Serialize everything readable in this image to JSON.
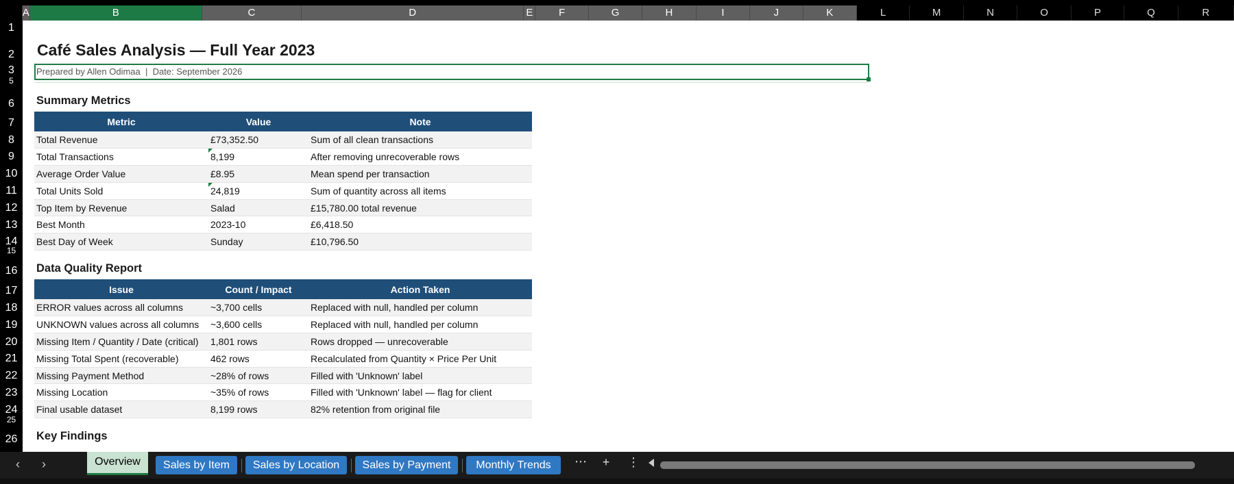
{
  "columns": [
    "A",
    "B",
    "C",
    "D",
    "E",
    "F",
    "G",
    "H",
    "I",
    "J",
    "K",
    "L",
    "M",
    "N",
    "O",
    "P",
    "Q",
    "R"
  ],
  "rows": [
    "1",
    "2",
    "3",
    "5",
    "6",
    "7",
    "8",
    "9",
    "10",
    "11",
    "12",
    "13",
    "14",
    "15",
    "16",
    "17",
    "18",
    "19",
    "20",
    "21",
    "22",
    "23",
    "24",
    "25",
    "26"
  ],
  "title": "Café Sales Analysis — Full Year 2023",
  "subtitle": "Prepared by Allen Odimaa  |  Date: September 2026",
  "summary": {
    "heading": "Summary Metrics",
    "headers": [
      "Metric",
      "Value",
      "Note"
    ],
    "rows": [
      [
        "Total Revenue",
        "£73,352.50",
        "Sum of all clean transactions"
      ],
      [
        "Total Transactions",
        "8,199",
        "After removing unrecoverable rows"
      ],
      [
        "Average Order Value",
        "£8.95",
        "Mean spend per transaction"
      ],
      [
        "Total Units Sold",
        "24,819",
        "Sum of quantity across all items"
      ],
      [
        "Top Item by Revenue",
        "Salad",
        "£15,780.00 total revenue"
      ],
      [
        "Best Month",
        "2023-10",
        "£6,418.50"
      ],
      [
        "Best Day of Week",
        "Sunday",
        "£10,796.50"
      ]
    ]
  },
  "quality": {
    "heading": "Data Quality Report",
    "headers": [
      "Issue",
      "Count / Impact",
      "Action Taken"
    ],
    "rows": [
      [
        "ERROR values across all columns",
        "~3,700 cells",
        "Replaced with null, handled per column"
      ],
      [
        "UNKNOWN values across all columns",
        "~3,600 cells",
        "Replaced with null, handled per column"
      ],
      [
        "Missing Item / Quantity / Date (critical)",
        "1,801 rows",
        "Rows dropped — unrecoverable"
      ],
      [
        "Missing Total Spent (recoverable)",
        "462 rows",
        "Recalculated from Quantity × Price Per Unit"
      ],
      [
        "Missing Payment Method",
        "~28% of rows",
        "Filled with 'Unknown' label"
      ],
      [
        "Missing Location",
        "~35% of rows",
        "Filled with 'Unknown' label — flag for client"
      ],
      [
        "Final usable dataset",
        "8,199 rows",
        "82% retention from original file"
      ]
    ]
  },
  "key_findings": {
    "heading": "Key Findings"
  },
  "tabs": {
    "active": "Overview",
    "others": [
      "Sales by Item",
      "Sales by Location",
      "Sales by Payment",
      "Monthly Trends"
    ]
  },
  "icons": {
    "prev": "chevron-left-icon",
    "next": "chevron-right-icon",
    "more_tabs": "ellipsis-icon",
    "add_sheet": "plus-icon",
    "options": "vertical-ellipsis-icon"
  },
  "colors": {
    "header_fill": "#1f4e79",
    "selection": "#1e7a45",
    "tab_blue": "#2f78c4"
  }
}
